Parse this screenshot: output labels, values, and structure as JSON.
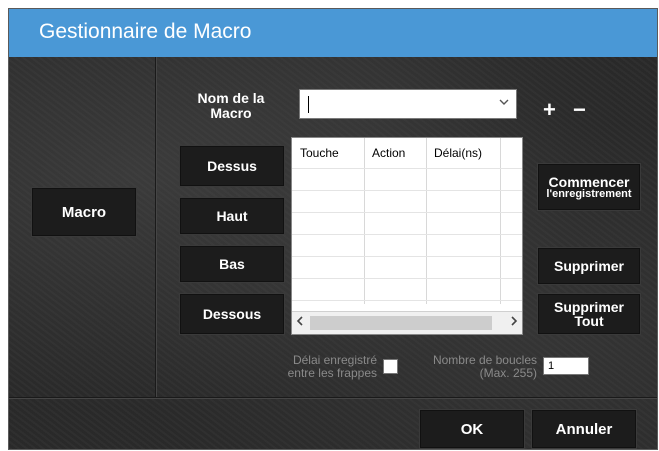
{
  "window": {
    "title": "Gestionnaire de Macro"
  },
  "sidebar": {
    "macro_label": "Macro"
  },
  "macro_name": {
    "label_line1": "Nom de la",
    "label_line2": "Macro",
    "value": "",
    "add_label": "+",
    "remove_label": "−"
  },
  "move_buttons": {
    "top": "Dessus",
    "up": "Haut",
    "down": "Bas",
    "bottom": "Dessous"
  },
  "table": {
    "columns": [
      "Touche",
      "Action",
      "Délai(ns)"
    ],
    "rows": []
  },
  "actions": {
    "record_line1": "Commencer",
    "record_line2": "l'enregistrement",
    "delete": "Supprimer",
    "delete_all_line1": "Supprimer",
    "delete_all_line2": "Tout"
  },
  "options": {
    "delay_line1": "Délai enregistré",
    "delay_line2": "entre les frappes",
    "loops_line1": "Nombre de boucles",
    "loops_line2": "(Max. 255)",
    "loops_value": "1"
  },
  "footer": {
    "ok": "OK",
    "cancel": "Annuler"
  },
  "colors": {
    "title_bar": "#4a98d6",
    "background": "#2b2b2b",
    "button": "#1c1c1c"
  },
  "icons": {
    "dropdown": "chevron-down-icon",
    "scroll_left": "chevron-left-icon",
    "scroll_right": "chevron-right-icon"
  }
}
